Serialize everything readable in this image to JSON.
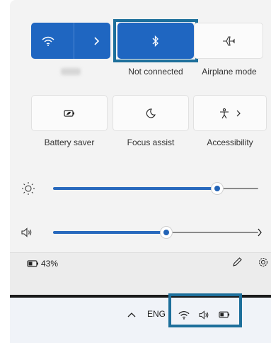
{
  "tiles": {
    "wifi": {
      "icon": "wifi-icon",
      "chevron": "chevron-right-icon"
    },
    "bluetooth": {
      "icon": "bluetooth-icon",
      "label": "Not connected"
    },
    "airplane": {
      "icon": "airplane-icon",
      "label": "Airplane mode"
    },
    "battery_saver": {
      "icon": "battery-saver-icon",
      "label": "Battery saver"
    },
    "focus_assist": {
      "icon": "moon-icon",
      "label": "Focus assist"
    },
    "accessibility": {
      "icon": "accessibility-icon",
      "chevron": "chevron-right-icon",
      "label": "Accessibility"
    }
  },
  "sliders": {
    "brightness": {
      "icon": "brightness-icon",
      "level": 0.8
    },
    "volume": {
      "icon": "speaker-icon",
      "level": 0.55,
      "chevron": "chevron-right-icon"
    }
  },
  "footer": {
    "battery_percent": "43%",
    "battery_icon": "battery-icon",
    "edit_icon": "pencil-icon",
    "settings_icon": "gear-icon"
  },
  "taskbar": {
    "chevron": "chevron-up-icon",
    "language": "ENG",
    "icons": [
      "wifi-icon",
      "speaker-icon",
      "battery-icon"
    ]
  },
  "colors": {
    "accent": "#1f66c1",
    "highlight_border": "#1d6f9b"
  }
}
